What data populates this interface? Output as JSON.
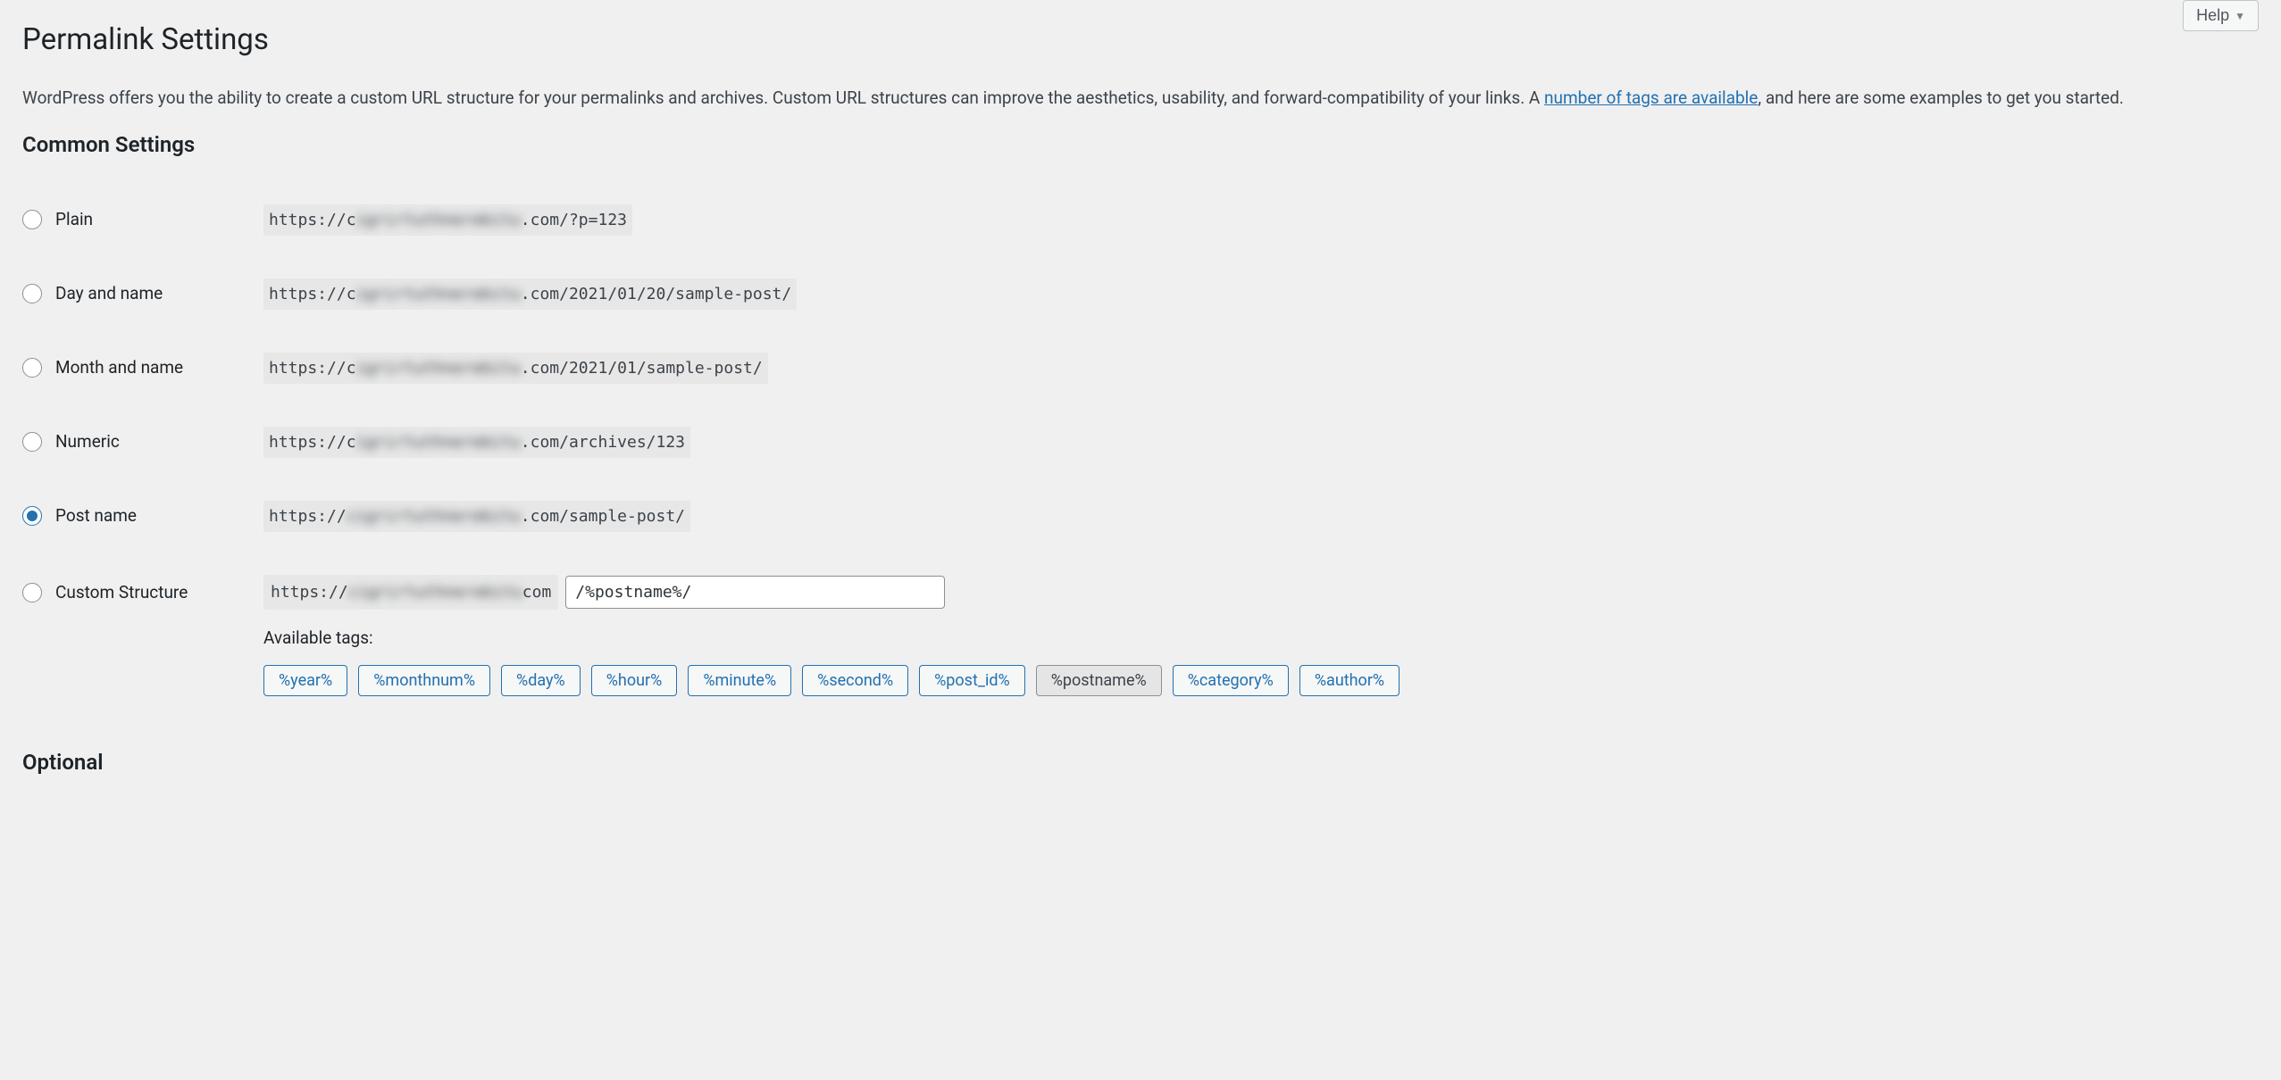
{
  "help_label": "Help",
  "page_title": "Permalink Settings",
  "intro_part1": "WordPress offers you the ability to create a custom URL structure for your permalinks and archives. Custom URL structures can improve the aesthetics, usability, and forward-compatibility of your links. A ",
  "intro_link": "number of tags are available",
  "intro_part2": ", and here are some examples to get you started.",
  "common_settings_heading": "Common Settings",
  "options": {
    "plain": {
      "label": "Plain",
      "url_prefix": "https://c",
      "url_blur": "igrirtuthnerebitu",
      "url_suffix": ".com/?p=123"
    },
    "day_name": {
      "label": "Day and name",
      "url_prefix": "https://c",
      "url_blur": "igrirtuthnerebitu",
      "url_suffix": ".com/2021/01/20/sample-post/"
    },
    "month_name": {
      "label": "Month and name",
      "url_prefix": "https://c",
      "url_blur": "igrirtuthnerebitu",
      "url_suffix": ".com/2021/01/sample-post/"
    },
    "numeric": {
      "label": "Numeric",
      "url_prefix": "https://c",
      "url_blur": "igrirtuthnerebitu",
      "url_suffix": ".com/archives/123"
    },
    "post_name": {
      "label": "Post name",
      "url_prefix": "https://",
      "url_blur": "cigrirtuthnerebitu",
      "url_suffix": ".com/sample-post/"
    },
    "custom": {
      "label": "Custom Structure",
      "url_prefix": "https://",
      "url_blur": "cigrirtuthnerebitu ",
      "url_suffix": "com",
      "input_value": "/%postname%/"
    }
  },
  "selected_option": "post_name",
  "available_tags_label": "Available tags:",
  "tags": [
    "%year%",
    "%monthnum%",
    "%day%",
    "%hour%",
    "%minute%",
    "%second%",
    "%post_id%",
    "%postname%",
    "%category%",
    "%author%"
  ],
  "active_tag": "%postname%",
  "optional_heading": "Optional"
}
